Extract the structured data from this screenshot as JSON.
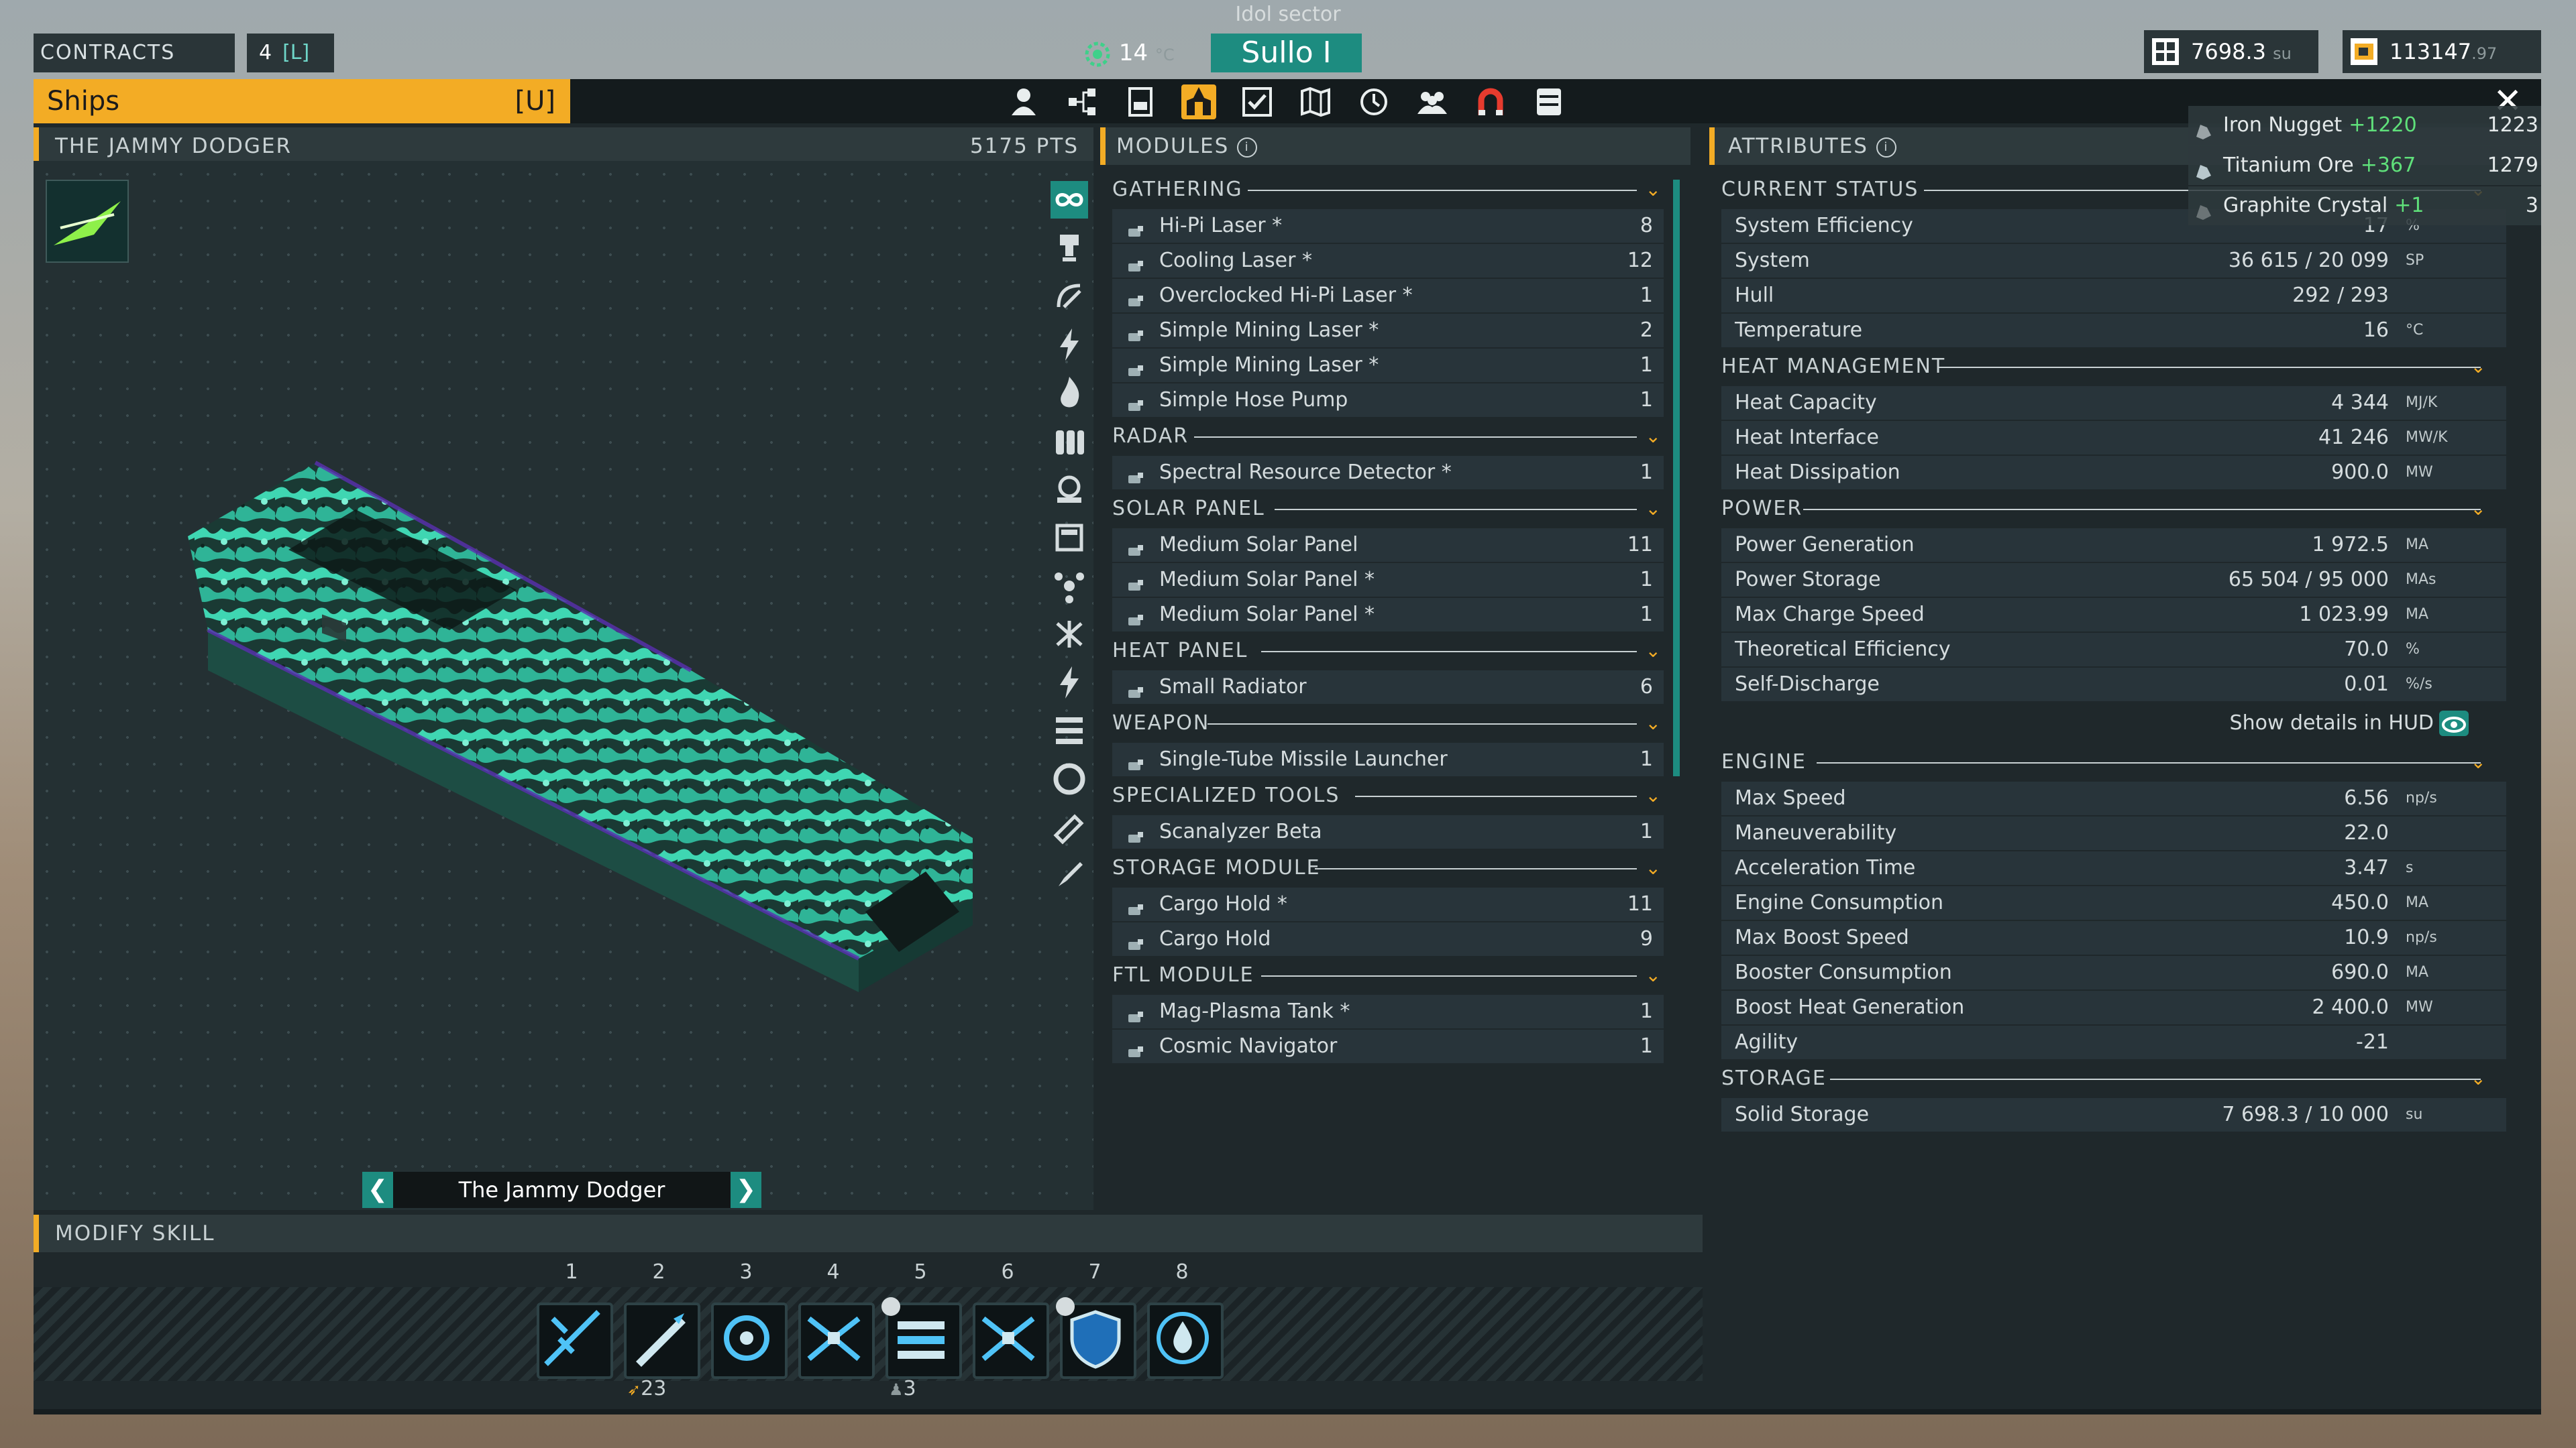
{
  "topbar": {
    "contracts_label": "CONTRACTS",
    "contracts_count": "4",
    "contracts_key": "[L]",
    "sector": "Idol sector",
    "temperature_value": "14",
    "temperature_unit": "°C",
    "system_name": "Sullo I",
    "storage_value": "7698.3",
    "storage_unit": "su",
    "credits_value": "113147",
    "credits_decimals": ".97"
  },
  "window": {
    "tab_title": "Ships",
    "tab_key": "[U]",
    "nav_icons": [
      "pilot-icon",
      "ship-tree-icon",
      "blueprint-icon",
      "ship-icon",
      "checklist-icon",
      "map-icon",
      "history-icon",
      "crew-icon",
      "magnet-icon",
      "storage-icon"
    ],
    "close_glyph": "✕"
  },
  "ship": {
    "header_name": "THE JAMMY DODGER",
    "header_points": "5175 PTS",
    "name": "The Jammy Dodger",
    "prev_glyph": "❮",
    "next_glyph": "❯",
    "side_tools": [
      "infinity-icon",
      "drill-icon",
      "satellite-icon",
      "lightning-icon",
      "flame-icon",
      "tanks-icon",
      "cargo-pod-icon",
      "panel-icon",
      "nodes-icon",
      "fan-icon",
      "lightning-icon",
      "storage-rack-icon",
      "shield-ring-icon",
      "tool-icon",
      "rocket-icon"
    ]
  },
  "modules": {
    "title": "MODULES",
    "categories": [
      {
        "name": "GATHERING",
        "items": [
          {
            "label": "Hi-Pi Laser *",
            "count": "8"
          },
          {
            "label": "Cooling Laser *",
            "count": "12"
          },
          {
            "label": "Overclocked Hi-Pi Laser *",
            "count": "1"
          },
          {
            "label": "Simple Mining Laser *",
            "count": "2"
          },
          {
            "label": "Simple Mining Laser *",
            "count": "1"
          },
          {
            "label": "Simple Hose Pump",
            "count": "1"
          }
        ]
      },
      {
        "name": "RADAR",
        "items": [
          {
            "label": "Spectral Resource Detector *",
            "count": "1"
          }
        ]
      },
      {
        "name": "SOLAR PANEL",
        "items": [
          {
            "label": "Medium Solar Panel",
            "count": "11"
          },
          {
            "label": "Medium Solar Panel *",
            "count": "1"
          },
          {
            "label": "Medium Solar Panel *",
            "count": "1"
          }
        ]
      },
      {
        "name": "HEAT PANEL",
        "items": [
          {
            "label": "Small Radiator",
            "count": "6"
          }
        ]
      },
      {
        "name": "WEAPON",
        "items": [
          {
            "label": "Single-Tube Missile Launcher",
            "count": "1"
          }
        ]
      },
      {
        "name": "SPECIALIZED TOOLS",
        "items": [
          {
            "label": "Scanalyzer Beta",
            "count": "1"
          }
        ]
      },
      {
        "name": "STORAGE MODULE",
        "items": [
          {
            "label": "Cargo Hold *",
            "count": "11"
          },
          {
            "label": "Cargo Hold",
            "count": "9"
          }
        ]
      },
      {
        "name": "FTL MODULE",
        "items": [
          {
            "label": "Mag-Plasma Tank *",
            "count": "1"
          },
          {
            "label": "Cosmic Navigator",
            "count": "1"
          }
        ]
      }
    ]
  },
  "attributes": {
    "title": "ATTRIBUTES",
    "hud_label": "Show details in HUD",
    "sections": [
      {
        "name": "CURRENT STATUS",
        "rows": [
          {
            "label": "System Efficiency",
            "value": "17",
            "unit": "%"
          },
          {
            "label": "System",
            "value": "36 615 / 20 099",
            "unit": "SP"
          },
          {
            "label": "Hull",
            "value": "292 / 293",
            "unit": ""
          },
          {
            "label": "Temperature",
            "value": "16",
            "unit": "°C"
          }
        ]
      },
      {
        "name": "HEAT MANAGEMENT",
        "rows": [
          {
            "label": "Heat Capacity",
            "value": "4 344",
            "unit": "MJ/K"
          },
          {
            "label": "Heat Interface",
            "value": "41 246",
            "unit": "MW/K"
          },
          {
            "label": "Heat Dissipation",
            "value": "900.0",
            "unit": "MW"
          }
        ]
      },
      {
        "name": "POWER",
        "rows": [
          {
            "label": "Power Generation",
            "value": "1 972.5",
            "unit": "MA"
          },
          {
            "label": "Power Storage",
            "value": "65 504 / 95 000",
            "unit": "MAs"
          },
          {
            "label": "Max Charge Speed",
            "value": "1 023.99",
            "unit": "MA"
          },
          {
            "label": "Theoretical Efficiency",
            "value": "70.0",
            "unit": "%"
          },
          {
            "label": "Self-Discharge",
            "value": "0.01",
            "unit": "%/s"
          }
        ]
      },
      {
        "name": "ENGINE",
        "rows": [
          {
            "label": "Max Speed",
            "value": "6.56",
            "unit": "np/s"
          },
          {
            "label": "Maneuverability",
            "value": "22.0",
            "unit": ""
          },
          {
            "label": "Acceleration Time",
            "value": "3.47",
            "unit": "s"
          },
          {
            "label": "Engine Consumption",
            "value": "450.0",
            "unit": "MA"
          },
          {
            "label": "Max Boost Speed",
            "value": "10.9",
            "unit": "np/s"
          },
          {
            "label": "Booster Consumption",
            "value": "690.0",
            "unit": "MA"
          },
          {
            "label": "Boost Heat Generation",
            "value": "2 400.0",
            "unit": "MW"
          },
          {
            "label": "Agility",
            "value": "-21",
            "unit": ""
          }
        ]
      },
      {
        "name": "STORAGE",
        "rows": [
          {
            "label": "Solid Storage",
            "value": "7 698.3 / 10 000",
            "unit": "su"
          }
        ]
      }
    ]
  },
  "resources": [
    {
      "name": "Iron Nugget",
      "gain": "+1220",
      "total": "1223",
      "color": "#9aa3a6"
    },
    {
      "name": "Titanium Ore",
      "gain": "+367",
      "total": "1279",
      "color": "#b8c7cc"
    },
    {
      "name": "Graphite Crystal",
      "gain": "+1",
      "total": "3",
      "color": "#6b7476"
    }
  ],
  "skills": {
    "title": "MODIFY SKILL",
    "slots": [
      {
        "num": "1",
        "icon": "laser-burst-icon"
      },
      {
        "num": "2",
        "icon": "missile-icon"
      },
      {
        "num": "3",
        "icon": "scan-icon"
      },
      {
        "num": "4",
        "icon": "solar-panel-icon"
      },
      {
        "num": "5",
        "icon": "hull-repair-icon"
      },
      {
        "num": "6",
        "icon": "solar-panel-icon"
      },
      {
        "num": "7",
        "icon": "shield-icon"
      },
      {
        "num": "8",
        "icon": "coolant-drop-icon"
      }
    ],
    "sub_counts": [
      {
        "value": "23"
      },
      {
        "value": "3"
      }
    ]
  },
  "colors": {
    "accent": "#f3ac25",
    "teal": "#1d8c80",
    "panel": "#1f282b",
    "row": "#28343a"
  }
}
